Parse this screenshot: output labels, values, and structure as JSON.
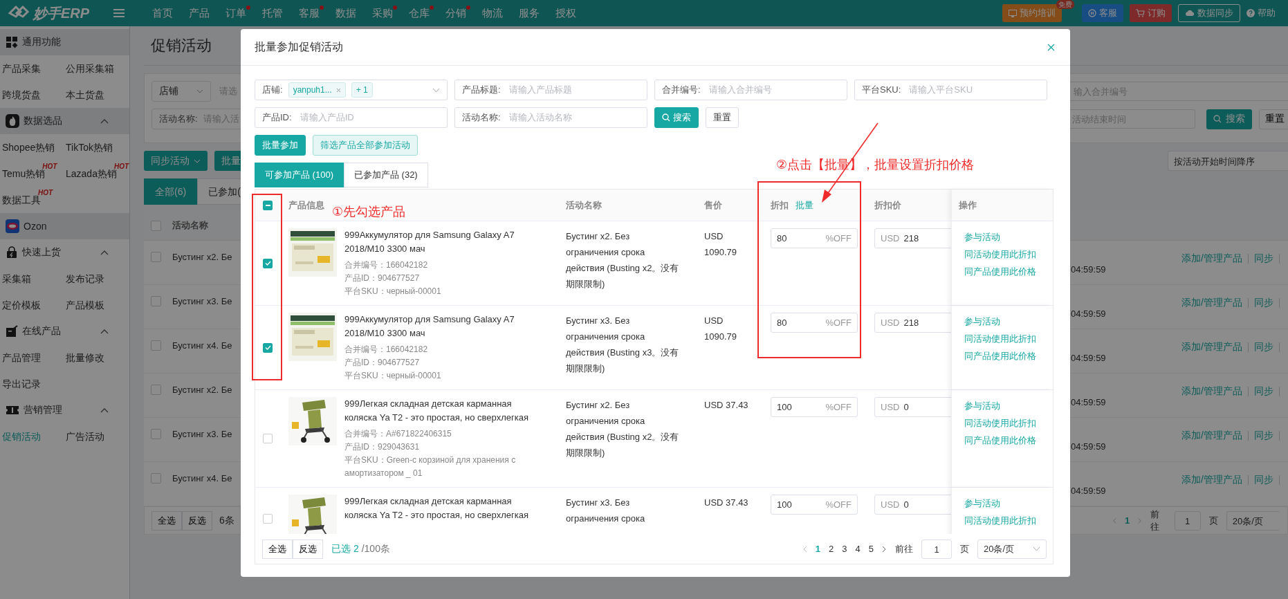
{
  "topbar": {
    "logo": "妙手ERP",
    "nav": [
      {
        "label": "首页",
        "dot": false
      },
      {
        "label": "产品",
        "dot": false
      },
      {
        "label": "订单",
        "dot": true
      },
      {
        "label": "托管",
        "dot": false
      },
      {
        "label": "客服",
        "dot": true
      },
      {
        "label": "数据",
        "dot": false
      },
      {
        "label": "采购",
        "dot": true
      },
      {
        "label": "仓库",
        "dot": true
      },
      {
        "label": "分销",
        "dot": true
      },
      {
        "label": "物流",
        "dot": false
      },
      {
        "label": "服务",
        "dot": false
      },
      {
        "label": "授权",
        "dot": false
      }
    ],
    "training": {
      "label": "预约培训",
      "badge": "免费"
    },
    "service": "客服",
    "order": "订购",
    "sync": "数据同步",
    "help": "帮助"
  },
  "sidebar": {
    "sections": [
      {
        "title": "通用功能",
        "shaded": true,
        "items": [
          {
            "label": "产品采集",
            "selected": false
          },
          {
            "label": "公用采集箱",
            "selected": false
          },
          {
            "label": "跨境货盘",
            "selected": false
          },
          {
            "label": "本土货盘",
            "selected": false
          }
        ]
      },
      {
        "title": "数据选品",
        "shaded": true,
        "expanded": true,
        "items": [
          {
            "label": "Shopee热销",
            "selected": false
          },
          {
            "label": "TikTok热销",
            "selected": false
          },
          {
            "label": "Temu热销",
            "badge": "HOT",
            "selected": false
          },
          {
            "label": "Lazada热销",
            "badge": "HOT",
            "selected": false
          },
          {
            "label": "数据工具",
            "badge": "HOT",
            "selected": false
          }
        ]
      },
      {
        "title": "Ozon",
        "shaded": true
      },
      {
        "title": "快速上货",
        "shaded": false,
        "expanded": true,
        "items": [
          {
            "label": "采集箱",
            "selected": false
          },
          {
            "label": "发布记录",
            "selected": false
          },
          {
            "label": "定价模板",
            "selected": false
          },
          {
            "label": "产品模板",
            "selected": false
          }
        ]
      },
      {
        "title": "在线产品",
        "shaded": false,
        "expanded": true,
        "items": [
          {
            "label": "产品管理",
            "selected": false
          },
          {
            "label": "批量修改",
            "selected": false
          },
          {
            "label": "导出记录",
            "selected": false
          }
        ]
      },
      {
        "title": "营销管理",
        "shaded": false,
        "expanded": true,
        "items": [
          {
            "label": "促销活动",
            "selected": true
          },
          {
            "label": "广告活动",
            "selected": false
          }
        ]
      }
    ]
  },
  "page": {
    "title": "促销活动",
    "filter": {
      "store_label": "店铺",
      "store_placeholder": "请选",
      "name_label": "活动名称:",
      "name_placeholder": "请输入活",
      "merge_placeholder": "输入合并编号",
      "end_placeholder": "活动结束时间",
      "search": "搜索",
      "reset": "重置"
    },
    "sync_button": "同步活动",
    "batch_button": "批量",
    "sort": "按活动开始时间降序",
    "tabs": [
      {
        "label": "全部(6)",
        "selected": true
      },
      {
        "label": "已参加(",
        "selected": false
      }
    ],
    "table": {
      "column_1": "活动名称",
      "all_checked": false,
      "rows": [
        {
          "checked": false,
          "name": "Бустинг x2. Бе",
          "time": "04:59:59",
          "actions": [
            "添加/管理产品",
            "同步"
          ]
        },
        {
          "checked": false,
          "name": "Бустинг x3. Бе",
          "time": "04:59:59",
          "actions": [
            "添加/管理产品",
            "同步"
          ]
        },
        {
          "checked": false,
          "name": "Бустинг x4. Бе",
          "time": "04:59:59",
          "actions": [
            "添加/管理产品",
            "同步"
          ]
        },
        {
          "checked": false,
          "name": "Бустинг x2. Бе",
          "time": "04:59:59",
          "actions": [
            "添加/管理产品",
            "同步"
          ]
        },
        {
          "checked": false,
          "name": "Бустинг x3. Бе",
          "time": "04:59:59",
          "actions": [
            "添加/管理产品",
            "同步"
          ]
        },
        {
          "checked": false,
          "name": "Бустинг x4. Бе",
          "time": "04:59:59",
          "actions": [
            "添加/管理产品",
            "同步"
          ]
        }
      ]
    },
    "pagination": {
      "select_all": "全选",
      "invert": "反选",
      "count": "6条",
      "pages": [
        {
          "label": "1",
          "selected": true
        }
      ],
      "goto": "前往",
      "page_input": "1",
      "page_unit": "页",
      "page_size": "20条/页"
    }
  },
  "modal": {
    "title": "批量参加促销活动",
    "filters": [
      {
        "kind": "tags",
        "label": "店铺:",
        "tags": [
          "yanpuh1...",
          "+ 1"
        ]
      },
      {
        "kind": "text",
        "label": "产品标题:",
        "placeholder": "请输入产品标题"
      },
      {
        "kind": "text",
        "label": "合并编号:",
        "placeholder": "请输入合并编号"
      },
      {
        "kind": "text",
        "label": "平台SKU:",
        "placeholder": "请输入平台SKU"
      },
      {
        "kind": "text",
        "label": "产品ID:",
        "placeholder": "请输入产品ID"
      },
      {
        "kind": "text",
        "label": "活动名称:",
        "placeholder": "请输入活动名称"
      }
    ],
    "search": "搜索",
    "reset": "重置",
    "batch_join": "批量参加",
    "filter_join": "筛选产品全部参加活动",
    "tabs": [
      {
        "label": "可参加产品 (100)",
        "selected": true
      },
      {
        "label": "已参加产品 (32)",
        "selected": false
      }
    ],
    "table": {
      "indeterminate": true,
      "columns": [
        "产品信息",
        "活动名称",
        "售价",
        "折扣",
        "折扣价",
        "操作"
      ],
      "batch_link": "批量",
      "rows": [
        {
          "checked": true,
          "image": {
            "kind": "picture"
          },
          "title": "999Аккумулятор для Samsung Galaxy A7 2018/M10 3300 мач",
          "meta": [
            "合并编号：166042182",
            "产品ID：904677527",
            "平台SKU：черный-00001"
          ],
          "activity": "Бустинг x2. Без ограничения срока действия (Busting x2。没有期限限制)",
          "price": "USD 1090.79",
          "discount": "80",
          "discount_unit": "%OFF",
          "currency": "USD",
          "deal_price": "218",
          "ops": [
            "参与活动",
            "同活动使用此折扣",
            "同产品使用此价格"
          ]
        },
        {
          "checked": true,
          "image": {
            "kind": "picture"
          },
          "title": "999Аккумулятор для Samsung Galaxy A7 2018/M10 3300 мач",
          "meta": [
            "合并编号：166042182",
            "产品ID：904677527",
            "平台SKU：черный-00001"
          ],
          "activity": "Бустинг x3. Без ограничения срока действия (Busting x3。没有期限限制)",
          "price": "USD 1090.79",
          "discount": "80",
          "discount_unit": "%OFF",
          "currency": "USD",
          "deal_price": "218",
          "ops": [
            "参与活动",
            "同活动使用此折扣",
            "同产品使用此价格"
          ]
        },
        {
          "checked": false,
          "image": {
            "kind": "picture"
          },
          "title": "999Легкая складная детская карманная коляска Ya T2 - это простая, но сверхлегкая",
          "meta": [
            "合并编号：A#671822406315",
            "产品ID：929043631",
            "平台SKU：Green-с корзиной для хранения с амортизатором _ 01"
          ],
          "activity": "Бустинг x2. Без ограничения срока действия (Busting x2。没有期限限制)",
          "price": "USD 37.43",
          "discount": "100",
          "discount_unit": "%OFF",
          "currency": "USD",
          "deal_price": "0",
          "ops": [
            "参与活动",
            "同活动使用此折扣",
            "同产品使用此价格"
          ]
        },
        {
          "checked": false,
          "image": {
            "kind": "picture"
          },
          "title": "999Легкая складная детская карманная коляска Ya T2 - это простая, но сверхлегкая",
          "meta": [],
          "activity": "Бустинг x3. Без ограничения срока",
          "price": "USD 37.43",
          "discount": "100",
          "discount_unit": "%OFF",
          "currency": "USD",
          "deal_price": "0",
          "ops": [
            "参与活动",
            "同活动使用此折扣"
          ]
        }
      ]
    },
    "footer": {
      "select_all": "全选",
      "invert": "反选",
      "selected": "已选 2",
      "total": "/100条",
      "pages": [
        {
          "label": "1",
          "selected": true
        },
        {
          "label": "2",
          "selected": false
        },
        {
          "label": "3",
          "selected": false
        },
        {
          "label": "4",
          "selected": false
        },
        {
          "label": "5",
          "selected": false
        }
      ],
      "goto": "前往",
      "page_input": "1",
      "page_unit": "页",
      "page_size": "20条/页"
    },
    "annotations": [
      {
        "text": "①先勾选产品"
      },
      {
        "text": "②点击【批量】，批量设置折扣价格"
      }
    ]
  }
}
